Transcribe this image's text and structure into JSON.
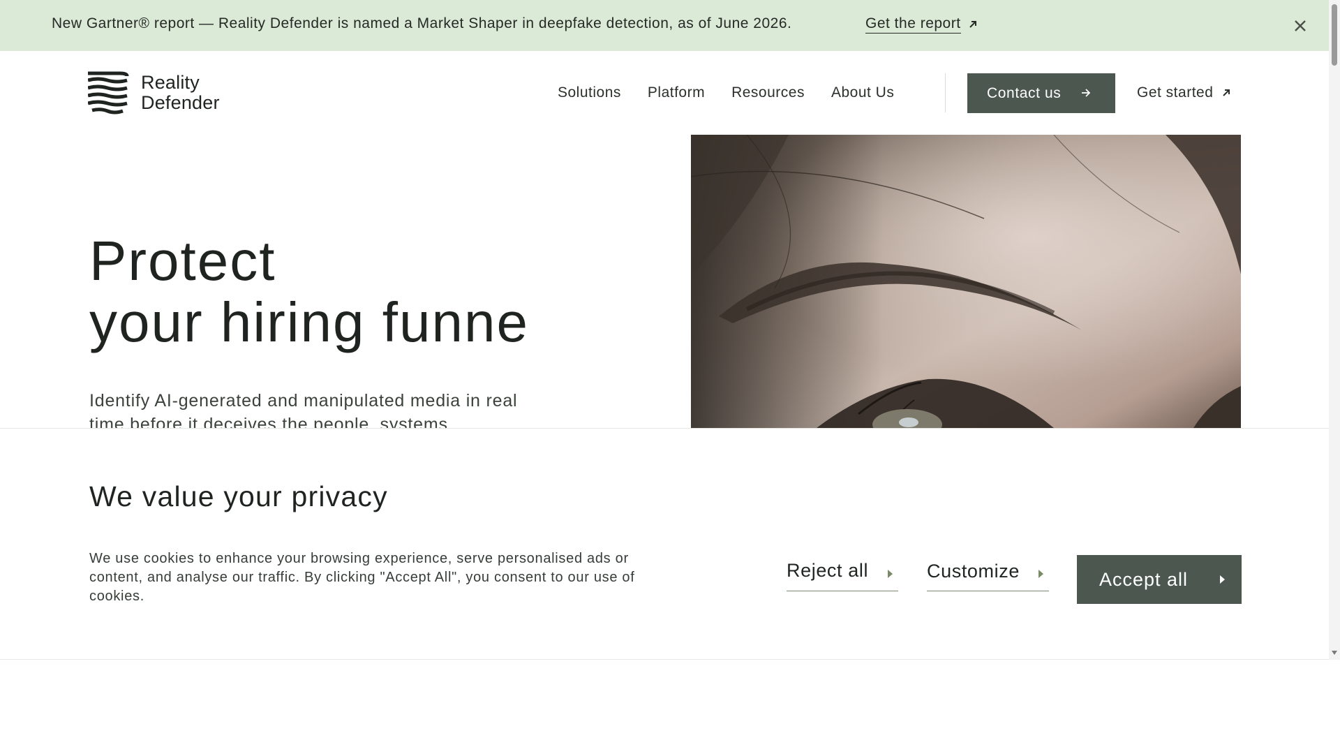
{
  "announcement": {
    "text": "New Gartner® report — Reality Defender is named a Market Shaper in deepfake detection, as of June 2026.",
    "link_label": "Get the report",
    "link_icon": "arrow-up-right-icon",
    "close_icon": "close-icon"
  },
  "header": {
    "logo_line1": "Reality",
    "logo_line2": "Defender",
    "nav": [
      "Solutions",
      "Platform",
      "Resources",
      "About Us"
    ],
    "contact_label": "Contact us",
    "get_started_label": "Get started"
  },
  "hero": {
    "title_line1": "Protect",
    "title_line2": "your hiring funne",
    "subtitle": "Identify AI-generated and manipulated media in real time before it deceives the people, systems"
  },
  "cookie": {
    "title": "We value your privacy",
    "body": "We use cookies to enhance your browsing experience, serve personalised ads or content, and analyse our traffic. By clicking \"Accept All\", you consent to our use of cookies.",
    "reject_label": "Reject all",
    "customize_label": "Customize",
    "accept_label": "Accept all"
  },
  "colors": {
    "announcement_bg": "#dbe9d7",
    "button_bg": "#4c5750",
    "underline_accent": "#7a8a66"
  }
}
